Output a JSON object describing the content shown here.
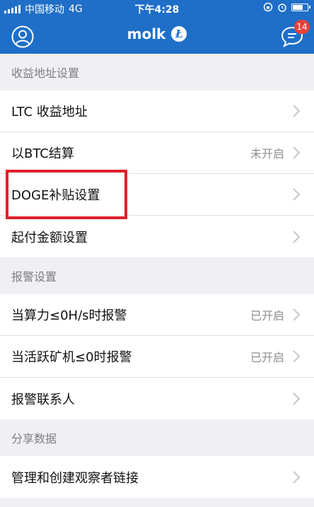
{
  "status_bar": {
    "carrier": "中国移动",
    "network": "4G",
    "time": "下午4:28"
  },
  "nav": {
    "title": "molk",
    "coin_badge": "Ł",
    "message_badge": "14"
  },
  "sections": [
    {
      "header": "收益地址设置",
      "rows": [
        {
          "label": "LTC 收益地址",
          "value": ""
        },
        {
          "label": "以BTC结算",
          "value": "未开启"
        },
        {
          "label": "DOGE补贴设置",
          "value": ""
        },
        {
          "label": "起付金额设置",
          "value": ""
        }
      ]
    },
    {
      "header": "报警设置",
      "rows": [
        {
          "label": "当算力≤0H/s时报警",
          "value": "已开启"
        },
        {
          "label": "当活跃矿机≤0时报警",
          "value": "已开启"
        },
        {
          "label": "报警联系人",
          "value": ""
        }
      ]
    },
    {
      "header": "分享数据",
      "rows": [
        {
          "label": "管理和创建观察者链接",
          "value": ""
        }
      ]
    }
  ],
  "colors": {
    "primary": "#1f6fc8",
    "badge": "#e8413a",
    "highlight": "#e02028"
  }
}
